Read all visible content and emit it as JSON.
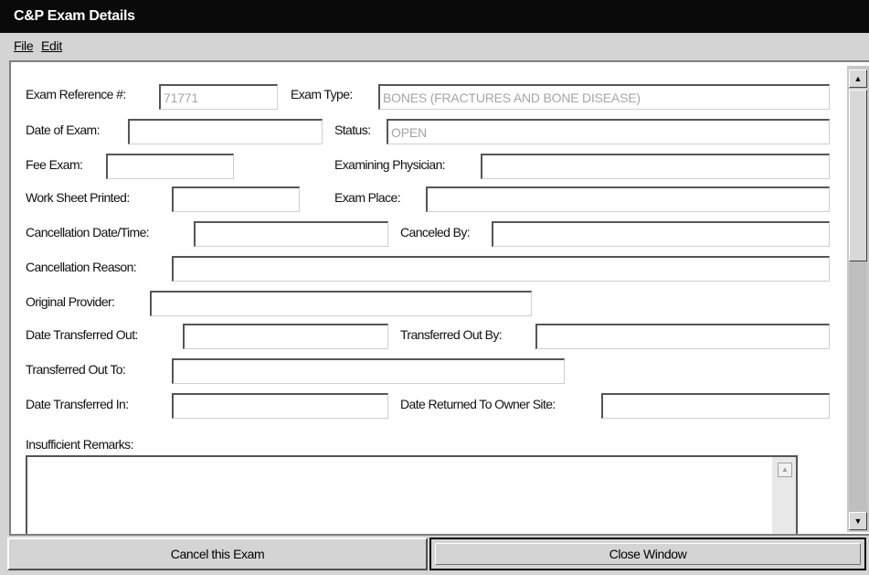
{
  "window": {
    "title": "C&P Exam Details"
  },
  "menu": {
    "file": "File",
    "edit": "Edit"
  },
  "form": {
    "exam_ref_label": "Exam Reference #:",
    "exam_ref_value": "71771",
    "exam_type_label": "Exam Type:",
    "exam_type_value": "BONES (FRACTURES AND BONE DISEASE)",
    "date_of_exam_label": "Date of Exam:",
    "date_of_exam_value": "",
    "status_label": "Status:",
    "status_value": "OPEN",
    "fee_exam_label": "Fee Exam:",
    "fee_exam_value": "",
    "examining_physician_label": "Examining Physician:",
    "examining_physician_value": "",
    "worksheet_printed_label": "Work Sheet Printed:",
    "worksheet_printed_value": "",
    "exam_place_label": "Exam Place:",
    "exam_place_value": "",
    "cancellation_datetime_label": "Cancellation Date/Time:",
    "cancellation_datetime_value": "",
    "canceled_by_label": "Canceled By:",
    "canceled_by_value": "",
    "cancellation_reason_label": "Cancellation Reason:",
    "cancellation_reason_value": "",
    "original_provider_label": "Original Provider:",
    "original_provider_value": "",
    "date_transferred_out_label": "Date Transferred Out:",
    "date_transferred_out_value": "",
    "transferred_out_by_label": "Transferred Out By:",
    "transferred_out_by_value": "",
    "transferred_out_to_label": "Transferred Out To:",
    "transferred_out_to_value": "",
    "date_transferred_in_label": "Date Transferred In:",
    "date_transferred_in_value": "",
    "date_returned_label": "Date Returned To Owner Site:",
    "date_returned_value": "",
    "insufficient_remarks_label": "Insufficient Remarks:",
    "insufficient_remarks_value": ""
  },
  "buttons": {
    "cancel_exam": "Cancel this Exam",
    "close_window": "Close Window"
  }
}
